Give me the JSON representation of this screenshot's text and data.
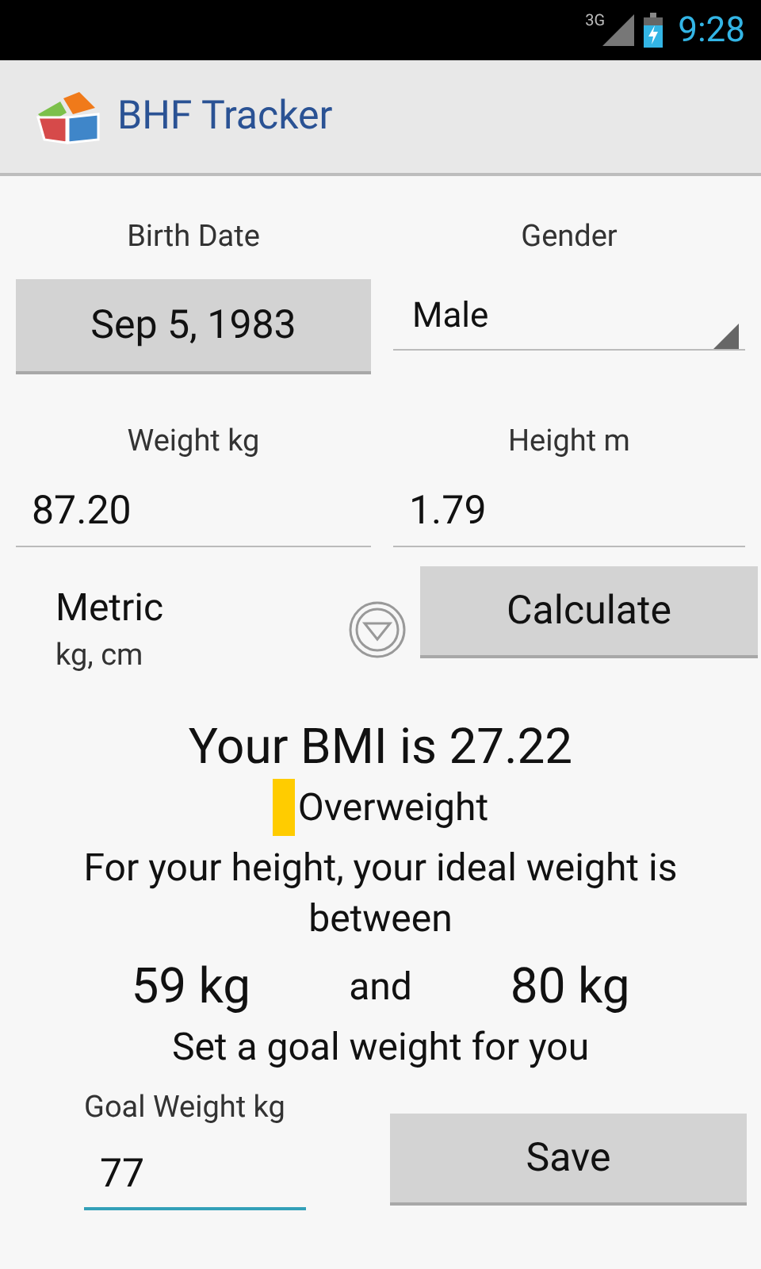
{
  "status_bar": {
    "network": "3G",
    "time": "9:28"
  },
  "action_bar": {
    "title": "BHF Tracker"
  },
  "birth_date": {
    "label": "Birth Date",
    "value": "Sep 5, 1983"
  },
  "gender": {
    "label": "Gender",
    "value": "Male"
  },
  "weight": {
    "label": "Weight  kg",
    "value": "87.20",
    "focused": false
  },
  "height": {
    "label": "Height  m",
    "value": "1.79",
    "focused": false
  },
  "units": {
    "title": "Metric",
    "subtitle": "kg, cm"
  },
  "calculate_button": "Calculate",
  "result": {
    "bmi": "Your BMI is  27.22",
    "category": "Overweight",
    "color": "#ffcc00",
    "ideal": "For your height, your ideal weight is between",
    "low": "59 kg",
    "joiner": "and",
    "high": "80 kg",
    "goal_prompt": "Set a goal weight for you"
  },
  "goal": {
    "label": "Goal Weight  kg",
    "value": "77",
    "focused": true
  },
  "save_button": "Save"
}
